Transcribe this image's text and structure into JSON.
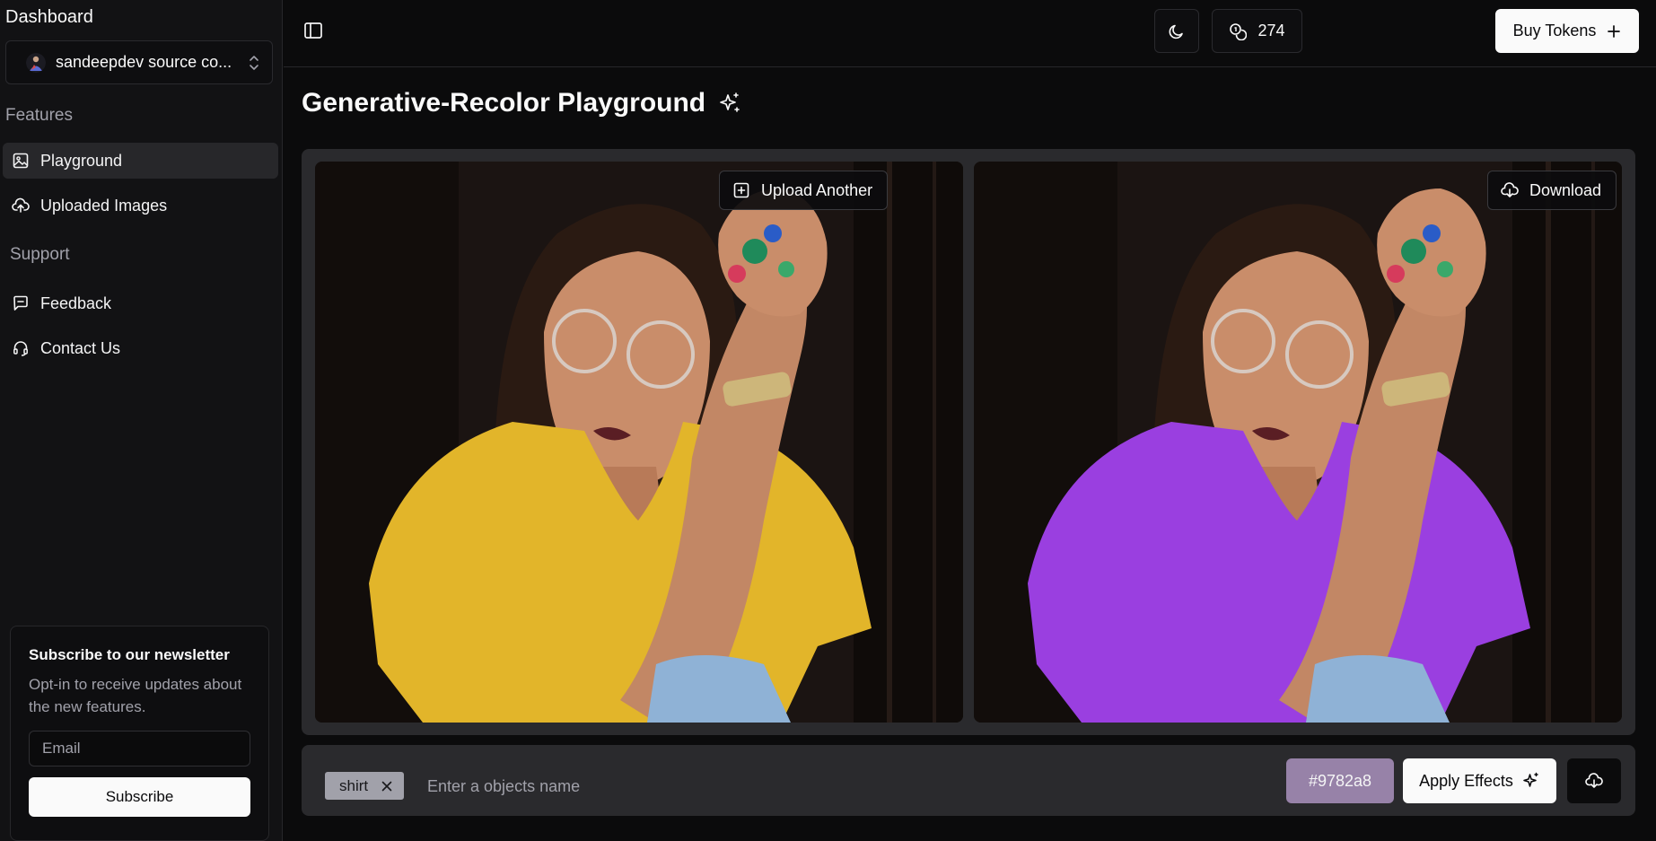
{
  "sidebar": {
    "title": "Dashboard",
    "account": {
      "name": "sandeepdev source co...",
      "avatar_icon": "avatar-image-icon"
    },
    "sections": {
      "features": "Features",
      "support": "Support"
    },
    "items": [
      {
        "label": "Playground",
        "icon": "image-icon",
        "active": true
      },
      {
        "label": "Uploaded Images",
        "icon": "cloud-upload-icon",
        "active": false
      },
      {
        "label": "Feedback",
        "icon": "message-icon",
        "active": false
      },
      {
        "label": "Contact Us",
        "icon": "headset-icon",
        "active": false
      }
    ],
    "newsletter": {
      "title": "Subscribe to our newsletter",
      "description": "Opt-in to receive updates about the new features.",
      "email_placeholder": "Email",
      "subscribe_label": "Subscribe"
    }
  },
  "header": {
    "tokens": "274",
    "buy_tokens_label": "Buy Tokens"
  },
  "main": {
    "title": "Generative-Recolor Playground",
    "upload_another_label": "Upload Another",
    "download_label": "Download",
    "object_chip": "shirt",
    "object_placeholder": "Enter a objects name",
    "color_value": "#9782a8",
    "apply_label": "Apply Effects"
  },
  "colors": {
    "original_shirt": "#e2b52a",
    "recolored_shirt": "#9a3fe0",
    "selected_color": "#9782a8"
  }
}
